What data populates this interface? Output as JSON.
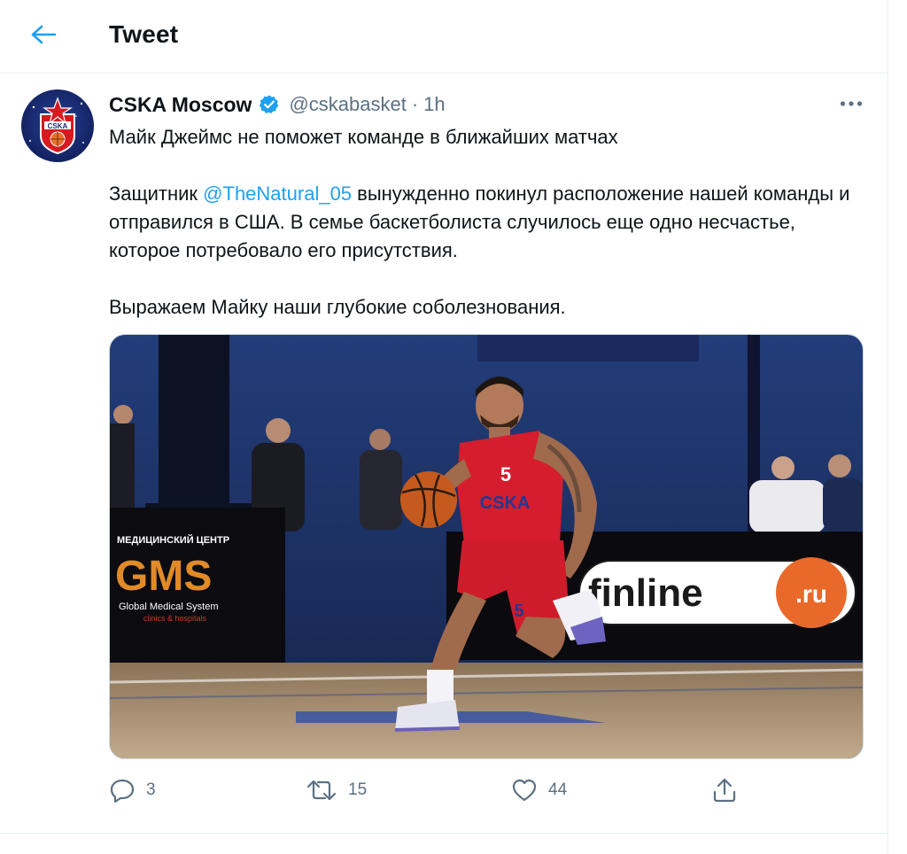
{
  "header": {
    "back_icon": "arrow-left-icon",
    "title": "Tweet"
  },
  "tweet": {
    "author_name": "CSKA Moscow",
    "verified": true,
    "handle": "@cskabasket",
    "separator": "·",
    "time": "1h",
    "avatar_text": "CSKA",
    "text": {
      "line1": "Майк Джеймс не поможет команде в ближайших матчах",
      "para2_prefix": "Защитник ",
      "mention": "@TheNatural_05",
      "para2_rest": " вынужденно покинул расположение нашей команды и отправился в США. В семье баскетболиста случилось еще одно несчастье, которое потребовало его присутствия.",
      "para3": "Выражаем Майку наши глубокие соболезнования."
    },
    "media": {
      "ad_left_top": "МЕДИЦИНСКИЙ ЦЕНТР",
      "ad_left_brand": "GMS",
      "ad_left_sub": "Global Medical System",
      "ad_left_sub2": "clinics & hospitals",
      "ad_right_brand": "finline",
      "ad_right_tld": ".ru",
      "jersey_number": "5",
      "jersey_text": "CSKA"
    },
    "actions": {
      "reply_count": "3",
      "retweet_count": "15",
      "like_count": "44"
    }
  },
  "colors": {
    "accent": "#1da1f2",
    "secondary_text": "#5b7083",
    "border": "#e6ecf0"
  }
}
